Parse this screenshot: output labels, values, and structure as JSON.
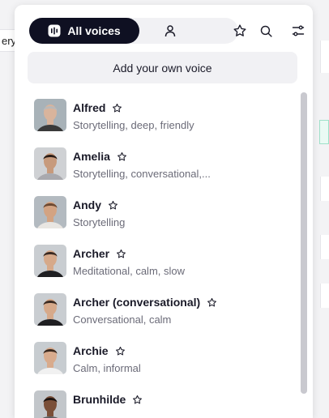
{
  "background": {
    "chip_text": "ery"
  },
  "toolbar": {
    "all_voices_label": "All voices",
    "icons": [
      "waveform-icon",
      "user-icon",
      "star-icon",
      "search-icon",
      "filter-sliders-icon"
    ]
  },
  "add_voice_label": "Add your own voice",
  "voices": [
    {
      "name": "Alfred",
      "description": "Storytelling, deep, friendly",
      "avatar": {
        "skin": "#d9b49c",
        "hair": "#b9b9b9",
        "shirt": "#3a3a3a",
        "bg": "#a8b2b8"
      }
    },
    {
      "name": "Amelia",
      "description": "Storytelling, conversational,...",
      "avatar": {
        "skin": "#c79a7c",
        "hair": "#2a1d17",
        "shirt": "#a9a9ae",
        "bg": "#cfd1d4"
      }
    },
    {
      "name": "Andy",
      "description": "Storytelling",
      "avatar": {
        "skin": "#d3a382",
        "hair": "#6e4a32",
        "shirt": "#e9e6e2",
        "bg": "#b3bac0"
      }
    },
    {
      "name": "Archer",
      "description": "Meditational, calm, slow",
      "avatar": {
        "skin": "#d6a98a",
        "hair": "#3a2a22",
        "shirt": "#1f1f22",
        "bg": "#c9cdd1"
      }
    },
    {
      "name": "Archer (conversational)",
      "description": "Conversational, calm",
      "avatar": {
        "skin": "#d6a98a",
        "hair": "#3a2a22",
        "shirt": "#1f1f22",
        "bg": "#c9cdd1"
      }
    },
    {
      "name": "Archie",
      "description": "Calm, informal",
      "avatar": {
        "skin": "#d8ab8d",
        "hair": "#3b2a20",
        "shirt": "#f1f1f1",
        "bg": "#c7ccd0"
      }
    },
    {
      "name": "Brunhilde",
      "description": "",
      "avatar": {
        "skin": "#7a4f38",
        "hair": "#1c120e",
        "shirt": "#5a5a5a",
        "bg": "#c2c6ca"
      }
    }
  ],
  "colors": {
    "accent": "#0f1022",
    "muted_text": "#6b6b78",
    "panel": "#f1f1f4"
  }
}
